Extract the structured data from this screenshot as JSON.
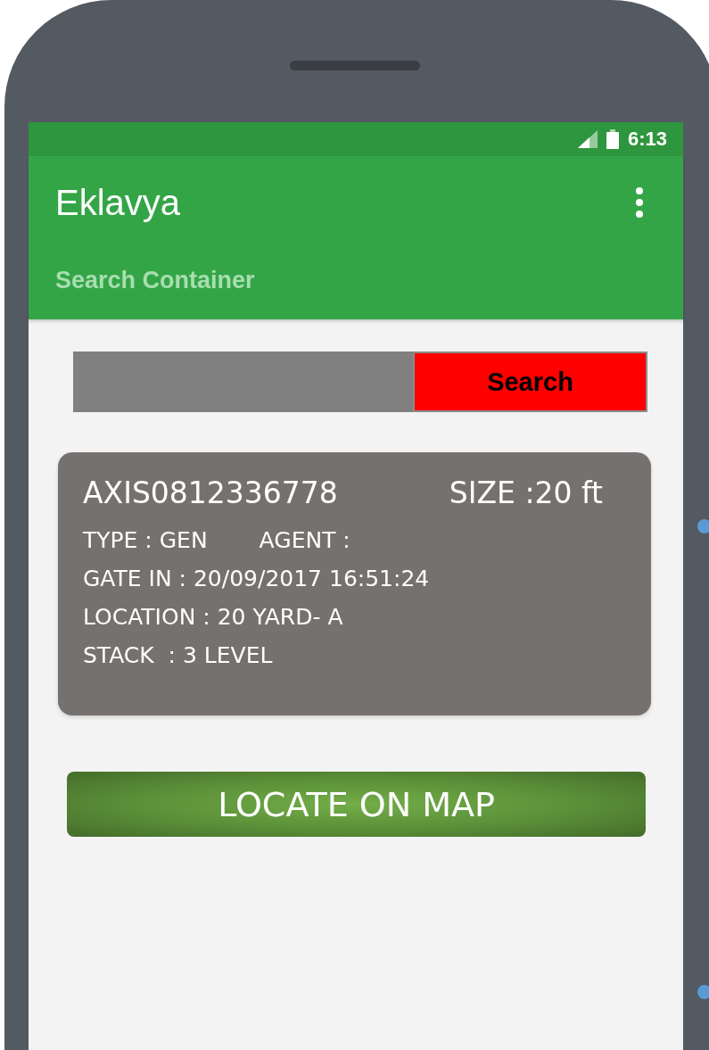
{
  "status_bar": {
    "time": "6:13"
  },
  "app_bar": {
    "title": "Eklavya",
    "subtitle": "Search Container"
  },
  "search": {
    "button": "Search"
  },
  "container": {
    "number": "AXIS0812336778",
    "size": "SIZE :20 ft",
    "type": "TYPE : GEN",
    "agent": "AGENT :",
    "gate_in": "GATE IN : 20/09/2017 16:51:24",
    "location": "LOCATION : 20 YARD- A",
    "stack": "STACK  : 3 LEVEL"
  },
  "action_button": "LOCATE ON MAP"
}
